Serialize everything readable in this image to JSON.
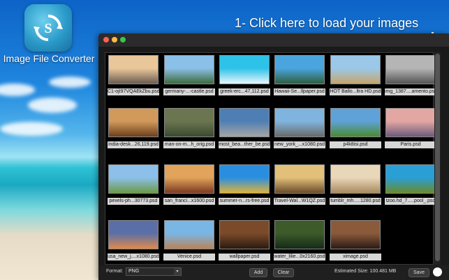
{
  "app": {
    "title": "Image File Converter"
  },
  "hint": {
    "text": "1- Click here to load your images"
  },
  "files": [
    {
      "name": "C1-ojI97VQAEkZbu.psd",
      "colors": [
        "#e9c79a",
        "#6b5c52"
      ]
    },
    {
      "name": "germany-...-castle.psd",
      "colors": [
        "#8bc0e8",
        "#3d6a3b"
      ]
    },
    {
      "name": "greek-erc...47,112.psd",
      "colors": [
        "#2dc2e8",
        "#e8f6fb"
      ]
    },
    {
      "name": "Hawaii-Se...llpaper.psd",
      "colors": [
        "#4aa5de",
        "#2f5d3e"
      ]
    },
    {
      "name": "HOT Ballo...ltra HD.psd",
      "colors": [
        "#9bc8e8",
        "#c6a56a"
      ]
    },
    {
      "name": "img_1387....amento.psd",
      "colors": [
        "#b5b5b5",
        "#545454"
      ]
    },
    {
      "name": "india-desk...26,119.psd",
      "colors": [
        "#d19a5b",
        "#6e3f1d"
      ]
    },
    {
      "name": "man-on-m...h_orig.psd",
      "colors": [
        "#6b7650",
        "#3b4a30"
      ]
    },
    {
      "name": "most_bea...ther_be.psd",
      "colors": [
        "#4e7fb4",
        "#a5a5a5"
      ]
    },
    {
      "name": "new_york_...x1080.psd",
      "colors": [
        "#7fb4de",
        "#6a6a6a"
      ]
    },
    {
      "name": "p4k8isi.psd",
      "colors": [
        "#5ea2d8",
        "#4a8b2f"
      ]
    },
    {
      "name": "Paris.psd",
      "colors": [
        "#e3a7a3",
        "#6d5a7c"
      ]
    },
    {
      "name": "pexels-ph...30773.psd",
      "colors": [
        "#8cc0ea",
        "#6a9a45"
      ]
    },
    {
      "name": "san_franci...x1600.psd",
      "colors": [
        "#e2a35a",
        "#7a3a22"
      ]
    },
    {
      "name": "summer-n...rs-free.psd",
      "colors": [
        "#2a8ee0",
        "#e0b33a"
      ]
    },
    {
      "name": "Travel-Wal...W1QZ.psd",
      "colors": [
        "#e2c07a",
        "#6a4a2a"
      ]
    },
    {
      "name": "tumblr_mh.....1280.psd",
      "colors": [
        "#e9d7b9",
        "#a88a5f"
      ]
    },
    {
      "name": "tzoo.hd_7.....pool_.psd",
      "colors": [
        "#2a9fd5",
        "#6a8a2a"
      ]
    },
    {
      "name": "usa_new_j....x1080.psd",
      "colors": [
        "#5a6fa8",
        "#e08a4a"
      ]
    },
    {
      "name": "Venice.psd",
      "colors": [
        "#79b6e6",
        "#b98457"
      ]
    },
    {
      "name": "wallpaper.psd",
      "colors": [
        "#7a4a2a",
        "#2a1a10"
      ]
    },
    {
      "name": "water_lilie...0x2160.psd",
      "colors": [
        "#3d5a2a",
        "#142a18"
      ]
    },
    {
      "name": "ximage.psd",
      "colors": [
        "#8a5a3a",
        "#2a1a14"
      ]
    }
  ],
  "bottom": {
    "format_label": "Format:",
    "format_value": "PNG",
    "add_label": "Add",
    "clear_label": "Clear",
    "estimated_label": "Estimated Size: 100.481 MB",
    "save_label": "Save"
  }
}
